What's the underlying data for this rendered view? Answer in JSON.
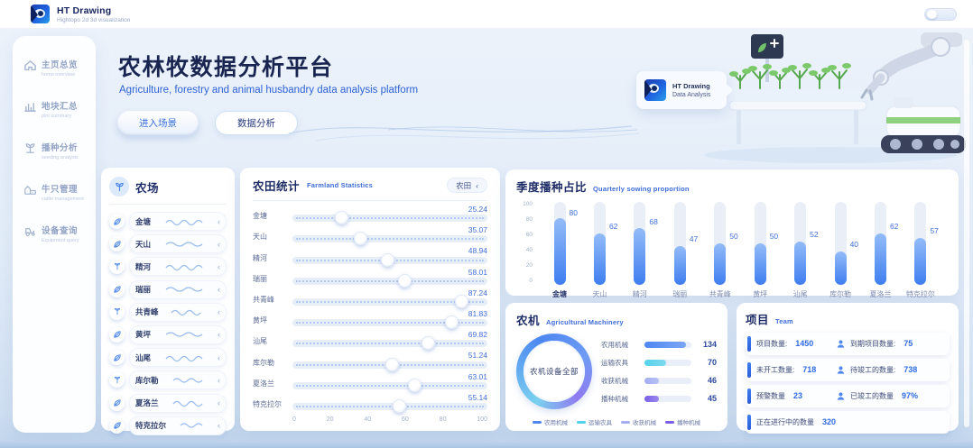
{
  "header": {
    "logo_title": "HT Drawing",
    "logo_subtitle": "Hightopo 2d 3d visualization"
  },
  "sidebar": {
    "items": [
      {
        "label": "主页总览",
        "sublabel": "home overview"
      },
      {
        "label": "地块汇总",
        "sublabel": "plot summary"
      },
      {
        "label": "播种分析",
        "sublabel": "seeding analysis"
      },
      {
        "label": "牛只管理",
        "sublabel": "cattle management"
      },
      {
        "label": "设备查询",
        "sublabel": "Equipment query"
      }
    ]
  },
  "hero": {
    "title": "农林牧数据分析平台",
    "subtitle": "Agriculture, forestry and animal husbandry data analysis platform",
    "primary_button": "进入场景",
    "secondary_button": "数据分析",
    "badge_title": "HT Drawing",
    "badge_subtitle": "Data Analysis"
  },
  "ui": {
    "chevron": "‹"
  },
  "farms": {
    "title": "农场",
    "items": [
      "金塘",
      "天山",
      "精河",
      "瑞丽",
      "共青峰",
      "黄坪",
      "汕尾",
      "库尔勒",
      "夏洛兰",
      "特克拉尔"
    ]
  },
  "farmland": {
    "title": "农田统计",
    "subtitle_en": "Farmland Statistics",
    "filter_label": "农田",
    "axis_ticks": [
      "0",
      "20",
      "40",
      "60",
      "80",
      "100"
    ],
    "sliders": [
      {
        "name": "金塘",
        "value": 25.24
      },
      {
        "name": "天山",
        "value": 35.07
      },
      {
        "name": "精河",
        "value": 48.94
      },
      {
        "name": "瑞丽",
        "value": 58.01
      },
      {
        "name": "共青峰",
        "value": 87.24
      },
      {
        "name": "黄坪",
        "value": 81.83
      },
      {
        "name": "汕尾",
        "value": 69.82
      },
      {
        "name": "库尔勒",
        "value": 51.24
      },
      {
        "name": "夏洛兰",
        "value": 63.01
      },
      {
        "name": "特克拉尔",
        "value": 55.14
      }
    ]
  },
  "chart_data": [
    {
      "type": "bar",
      "title": "季度播种占比",
      "subtitle": "Quarterly sowing proportion",
      "categories": [
        "金塘",
        "天山",
        "精河",
        "瑞丽",
        "共青峰",
        "黄坪",
        "汕尾",
        "库尔勒",
        "夏洛兰",
        "特克拉尔"
      ],
      "values": [
        80,
        62,
        68,
        47,
        50,
        50,
        52,
        40,
        62,
        57
      ],
      "xlabel": "",
      "ylabel": "",
      "ylim": [
        0,
        100
      ],
      "yticks": [
        100,
        80,
        60,
        40,
        20,
        0
      ],
      "grid": false,
      "legend_position": "none",
      "bar_color": "#5b8ff9"
    },
    {
      "type": "bar",
      "orientation": "horizontal",
      "title": "农机",
      "subtitle": "Agricultural Machinery",
      "center_label": "农机设备全部",
      "categories": [
        "农用机械",
        "运输农具",
        "收获机械",
        "播种机械"
      ],
      "values": [
        134,
        70,
        46,
        45
      ],
      "colors": [
        "#4d87f2",
        "#54d2ea",
        "#a3aef2",
        "#7a5fe8"
      ],
      "xmax": 150,
      "legend_position": "bottom"
    }
  ],
  "projects": {
    "title": "项目",
    "subtitle_en": "Team",
    "rows": [
      {
        "left_label": "项目数量:",
        "left_value": "1450",
        "right_label": "到期项目数量:",
        "right_value": "75"
      },
      {
        "left_label": "未开工数量:",
        "left_value": "718",
        "right_label": "待竣工的数量:",
        "right_value": "738"
      },
      {
        "left_label": "预警数量",
        "left_value": "23",
        "right_label": "已竣工的数量",
        "right_value": "97%"
      },
      {
        "left_label": "正在进行中的数量",
        "left_value": "320"
      }
    ]
  },
  "colors": {
    "accent": "#3370ff",
    "title_navy": "#1d2c66",
    "bar_fill": "#3f7ef0",
    "cyan": "#54d2ea",
    "periwinkle": "#a3aef2",
    "purple": "#7a5fe8"
  }
}
